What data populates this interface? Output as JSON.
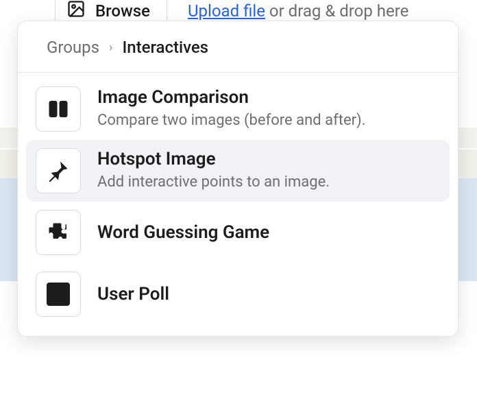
{
  "top": {
    "browse_label": "Browse",
    "upload_link": "Upload file",
    "drop_suffix": " or drag & drop here"
  },
  "breadcrumb": {
    "parent": "Groups",
    "current": "Interactives"
  },
  "options": [
    {
      "title": "Image Comparison",
      "desc": "Compare two images (before and after)."
    },
    {
      "title": "Hotspot Image",
      "desc": "Add interactive points to an image."
    },
    {
      "title": "Word Guessing Game"
    },
    {
      "title": "User Poll"
    }
  ]
}
